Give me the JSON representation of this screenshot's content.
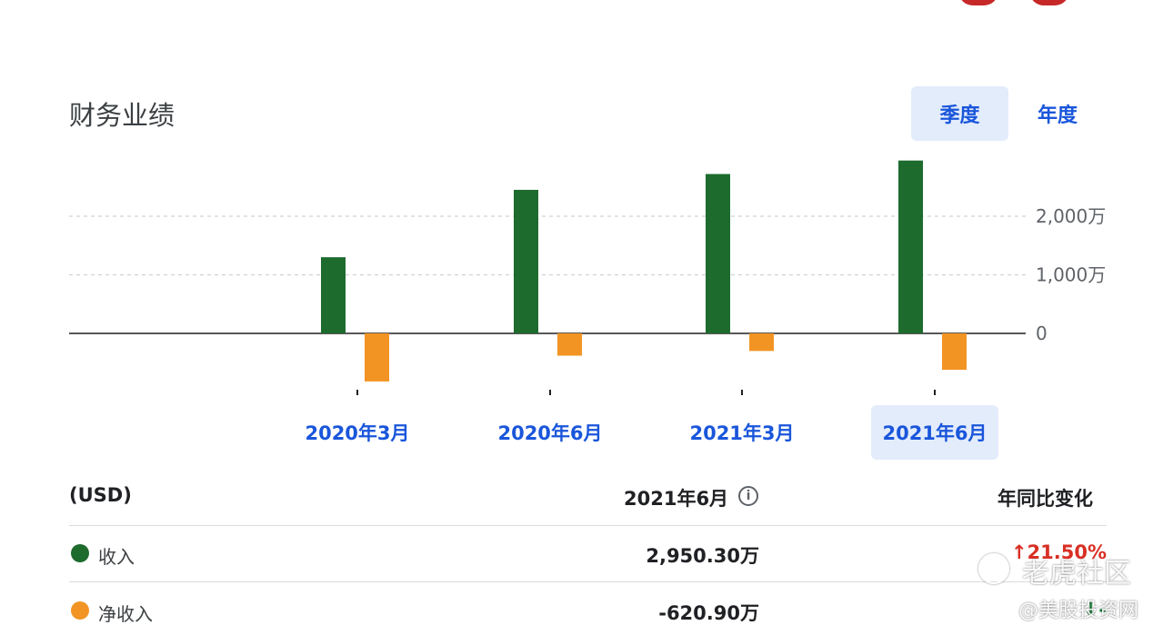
{
  "header": {
    "title": "财务业绩",
    "toggles": [
      {
        "label": "季度",
        "active": true
      },
      {
        "label": "年度",
        "active": false
      }
    ]
  },
  "colors": {
    "revenue": "#1e6b2e",
    "net_income": "#f29423",
    "link": "#1a56db",
    "up": "#d93025",
    "down": "#188038"
  },
  "chart_data": {
    "type": "bar",
    "categories": [
      "2020年3月",
      "2020年6月",
      "2021年3月",
      "2021年6月"
    ],
    "selected_category": "2021年6月",
    "series": [
      {
        "name": "收入",
        "values": [
          1300,
          2450,
          2720,
          2950.3
        ]
      },
      {
        "name": "净收入",
        "values": [
          -820,
          -380,
          -300,
          -620.9
        ]
      }
    ],
    "y_ticks": [
      {
        "value": 0,
        "label": "0"
      },
      {
        "value": 1000,
        "label": "1,000万"
      },
      {
        "value": 2000,
        "label": "2,000万"
      }
    ],
    "ylim": [
      -1000,
      3000
    ],
    "grid": true,
    "y_axis_side": "right"
  },
  "table": {
    "col_unit": "(USD)",
    "col_period": "2021年6月",
    "col_change": "年同比变化",
    "rows": [
      {
        "label": "收入",
        "value": "2,950.30万",
        "change": "↑21.50%",
        "direction": "up"
      },
      {
        "label": "净收入",
        "value": "-620.90万",
        "change": "↓-",
        "direction": "down"
      }
    ]
  },
  "watermarks": {
    "line1": "老虎社区",
    "line2": "@美股投资网"
  }
}
